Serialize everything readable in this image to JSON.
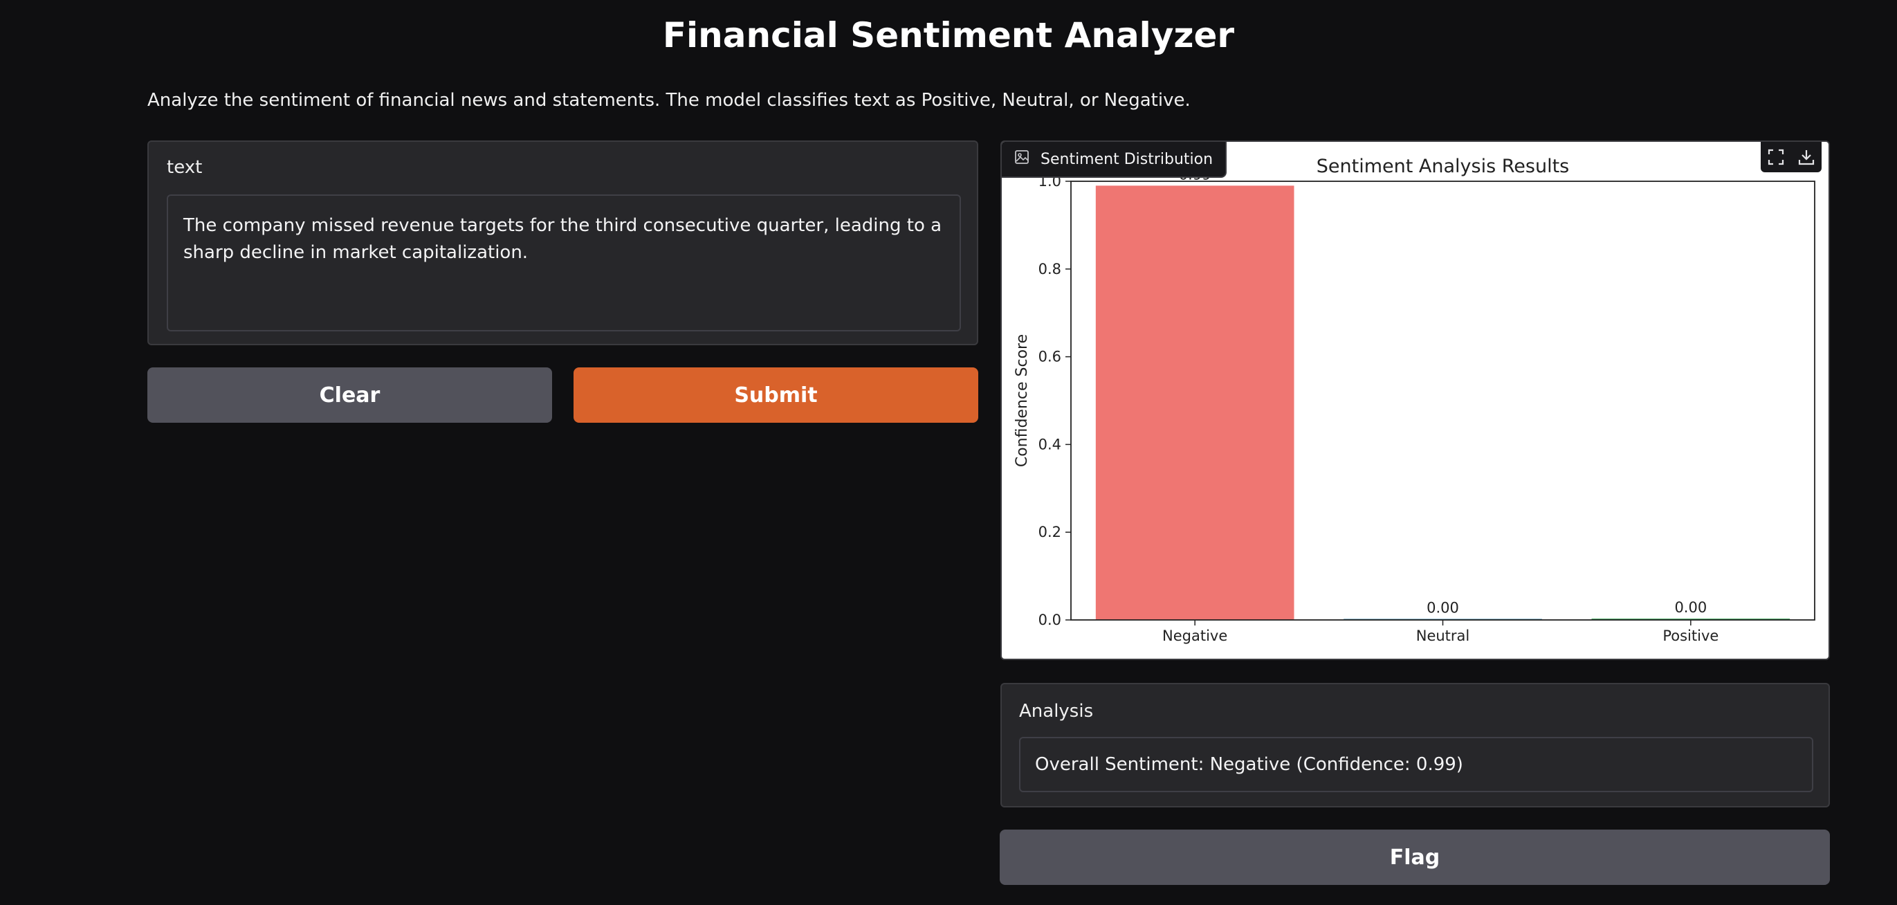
{
  "app": {
    "title": "Financial Sentiment Analyzer",
    "description": "Analyze the sentiment of financial news and statements. The model classifies text as Positive, Neutral, or Negative."
  },
  "input": {
    "label": "text",
    "value": "The company missed revenue targets for the third consecutive quarter, leading to a sharp decline in market capitalization."
  },
  "buttons": {
    "clear": "Clear",
    "submit": "Submit",
    "flag": "Flag"
  },
  "plot": {
    "tag_label": "Sentiment Distribution",
    "tag_icon": "image-icon",
    "tools": [
      "fullscreen-icon",
      "download-icon"
    ]
  },
  "chart_data": {
    "type": "bar",
    "title": "Sentiment Analysis Results",
    "xlabel": "",
    "ylabel": "Confidence Score",
    "categories": [
      "Negative",
      "Neutral",
      "Positive"
    ],
    "values": [
      0.99,
      0.0,
      0.003
    ],
    "value_labels": [
      "0.99",
      "0.00",
      "0.00"
    ],
    "colors": [
      "#ef7672",
      "#3b82a6",
      "#3fa35b"
    ],
    "ylim": [
      0,
      1.0
    ],
    "yticks": [
      "0.0",
      "0.2",
      "0.4",
      "0.6",
      "0.8",
      "1.0"
    ],
    "grid": false
  },
  "analysis": {
    "label": "Analysis",
    "value": "Overall Sentiment: Negative (Confidence: 0.99)"
  }
}
